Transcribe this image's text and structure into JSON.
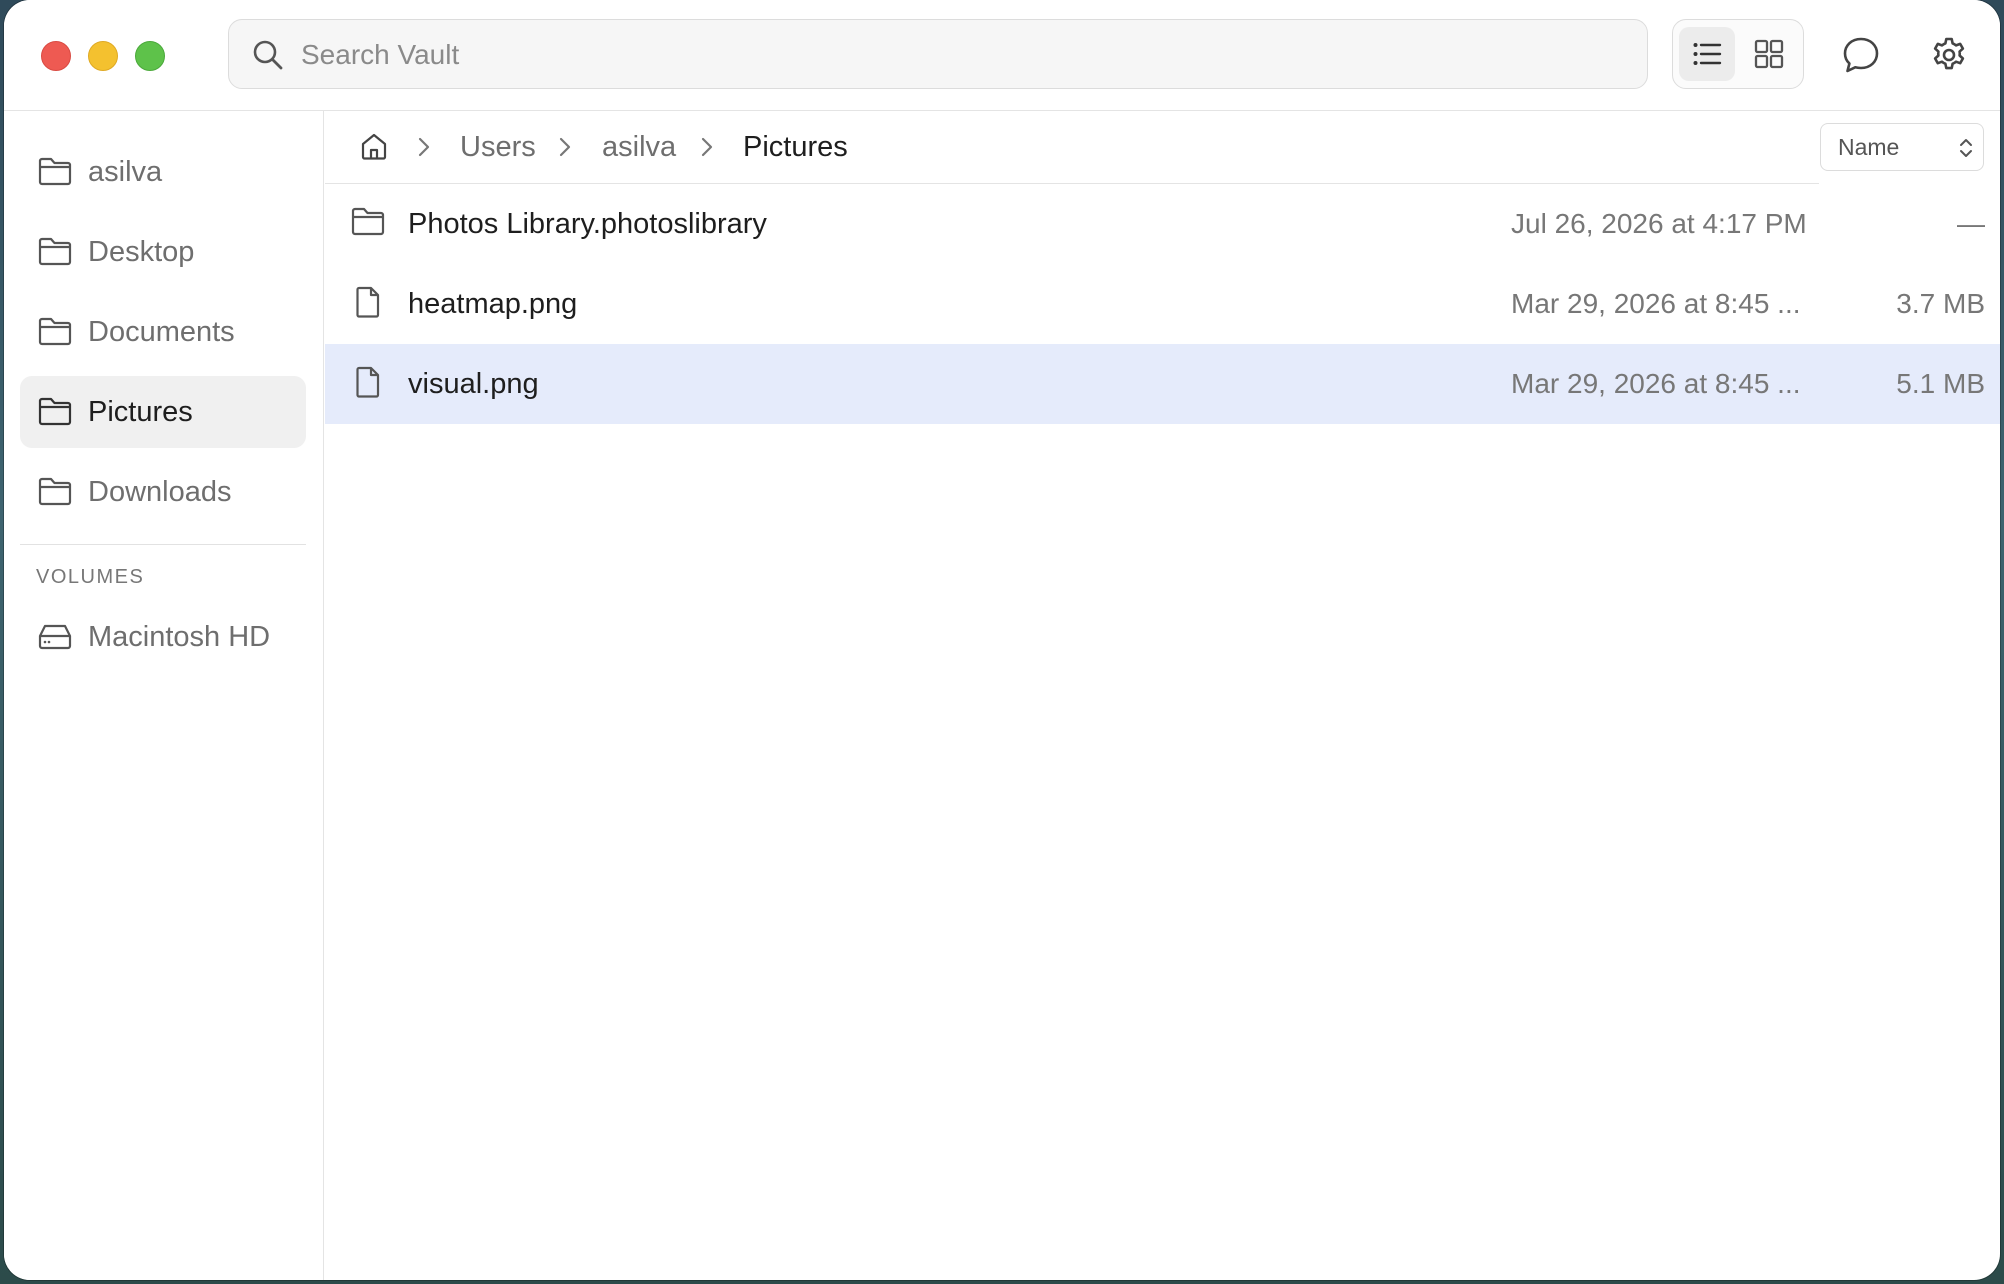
{
  "search": {
    "placeholder": "Search Vault"
  },
  "sidebar": {
    "items": [
      {
        "label": "asilva"
      },
      {
        "label": "Desktop"
      },
      {
        "label": "Documents"
      },
      {
        "label": "Pictures",
        "selected": true
      },
      {
        "label": "Downloads"
      }
    ],
    "volumes_heading": "VOLUMES",
    "volumes": [
      {
        "label": "Macintosh HD"
      }
    ]
  },
  "breadcrumb": [
    "Users",
    "asilva",
    "Pictures"
  ],
  "sort": {
    "selected": "Name"
  },
  "files": [
    {
      "name": "Photos Library.photoslibrary",
      "date": "Jul 26, 2026 at 4:17 PM",
      "size": "—",
      "icon": "folder-icon"
    },
    {
      "name": "heatmap.png",
      "date": "Mar 29, 2026 at 8:45 ...",
      "size": "3.7 MB",
      "icon": "file-icon"
    },
    {
      "name": "visual.png",
      "date": "Mar 29, 2026 at 8:45 ...",
      "size": "5.1 MB",
      "icon": "file-icon",
      "selected": true
    }
  ],
  "colors": {
    "selection": "#e5ebfb",
    "close": "#ee5a52",
    "minimize": "#f4c12f",
    "zoom": "#5ec24a"
  }
}
